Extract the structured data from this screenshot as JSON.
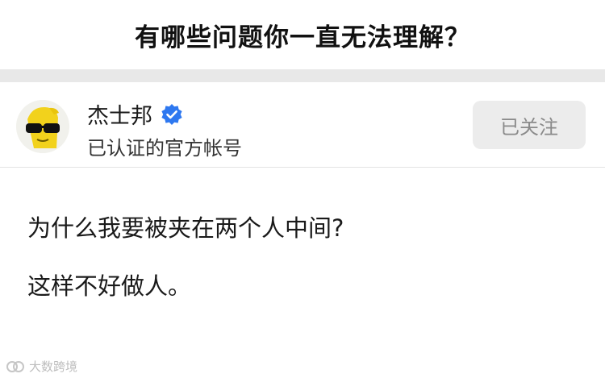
{
  "question": {
    "title": "有哪些问题你一直无法理解？"
  },
  "author": {
    "name": "杰士邦",
    "subtitle": "已认证的官方帐号",
    "verified": true,
    "follow_label": "已关注"
  },
  "answer": {
    "paragraphs": [
      "为什么我要被夹在两个人中间?",
      "这样不好做人。"
    ]
  },
  "watermark": {
    "text": "大数跨境"
  },
  "colors": {
    "verified_badge": "#2e78f0",
    "avatar_yellow": "#f2d21c",
    "follow_button_bg": "#ececec",
    "divider_band": "#e8e8e8"
  },
  "icons": {
    "avatar": "sunglasses-mascot-icon",
    "verified": "verified-badge-icon",
    "watermark": "brand-logo-icon"
  }
}
